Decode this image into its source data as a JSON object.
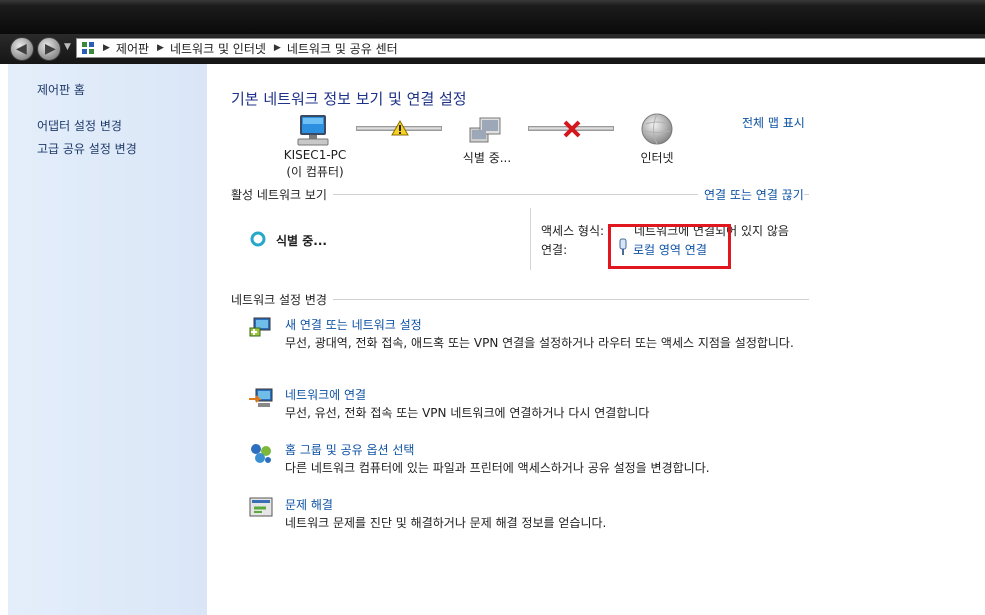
{
  "breadcrumb": {
    "items": [
      "제어판",
      "네트워크 및 인터넷",
      "네트워크 및 공유 센터"
    ]
  },
  "sidebar": {
    "items": [
      {
        "label": "제어판 홈"
      },
      {
        "label": "어댑터 설정 변경"
      },
      {
        "label": "고급 공유 설정 변경"
      }
    ]
  },
  "main": {
    "title": "기본 네트워크 정보 보기 및 연결 설정",
    "full_map_link": "전체 맵 표시",
    "map": {
      "computer_name": "KISEC1-PC",
      "computer_sub": "(이 컴퓨터)",
      "middle_label": "식별 중...",
      "internet_label": "인터넷"
    },
    "active_section": {
      "label": "활성 네트워크 보기",
      "action_link": "연결 또는 연결 끊기",
      "network_name": "식별 중...",
      "access_label": "액세스 형식:",
      "access_value": "네트워크에 연결되어 있지 않음",
      "connection_label": "연결:",
      "connection_value": "로컬 영역 연결"
    },
    "settings_section": {
      "label": "네트워크 설정 변경",
      "tasks": [
        {
          "title": "새 연결 또는 네트워크 설정",
          "desc": "무선, 광대역, 전화 접속, 애드혹 또는 VPN 연결을 설정하거나 라우터 또는 액세스 지점을 설정합니다.",
          "icon": "new-connection-icon"
        },
        {
          "title": "네트워크에 연결",
          "desc": "무선, 유선, 전화 접속 또는 VPN 네트워크에 연결하거나 다시 연결합니다",
          "icon": "connect-network-icon"
        },
        {
          "title": "홈 그룹 및 공유 옵션 선택",
          "desc": "다른 네트워크 컴퓨터에 있는 파일과 프린터에 액세스하거나 공유 설정을 변경합니다.",
          "icon": "homegroup-icon"
        },
        {
          "title": "문제 해결",
          "desc": "네트워크 문제를 진단 및 해결하거나 문제 해결 정보를 얻습니다.",
          "icon": "troubleshoot-icon"
        }
      ]
    }
  },
  "colors": {
    "link": "#0d52a3",
    "title": "#1e3287",
    "highlight": "#e0171f",
    "sidebar": "#e4eefb"
  }
}
